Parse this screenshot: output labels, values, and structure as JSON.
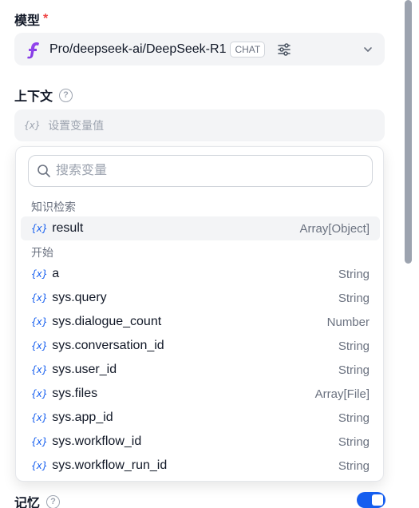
{
  "model_section": {
    "label": "模型",
    "required_mark": "*",
    "selected_model": "Pro/deepseek-ai/DeepSeek-R1",
    "mode_badge": "CHAT"
  },
  "context_section": {
    "label": "上下文",
    "input_placeholder": "设置变量值"
  },
  "variable_picker": {
    "search_placeholder": "搜索变量",
    "groups": [
      {
        "title": "知识检索",
        "items": [
          {
            "name": "result",
            "type": "Array[Object]"
          }
        ]
      },
      {
        "title": "开始",
        "items": [
          {
            "name": "a",
            "type": "String"
          },
          {
            "name": "sys.query",
            "type": "String"
          },
          {
            "name": "sys.dialogue_count",
            "type": "Number"
          },
          {
            "name": "sys.conversation_id",
            "type": "String"
          },
          {
            "name": "sys.user_id",
            "type": "String"
          },
          {
            "name": "sys.files",
            "type": "Array[File]"
          },
          {
            "name": "sys.app_id",
            "type": "String"
          },
          {
            "name": "sys.workflow_id",
            "type": "String"
          },
          {
            "name": "sys.workflow_run_id",
            "type": "String"
          }
        ]
      }
    ]
  },
  "memory_section": {
    "label": "记忆",
    "enabled": true
  },
  "icons": {
    "variable_glyph": "{x}",
    "help_glyph": "?"
  },
  "colors": {
    "accent": "#155eef",
    "required": "#ef4444"
  }
}
